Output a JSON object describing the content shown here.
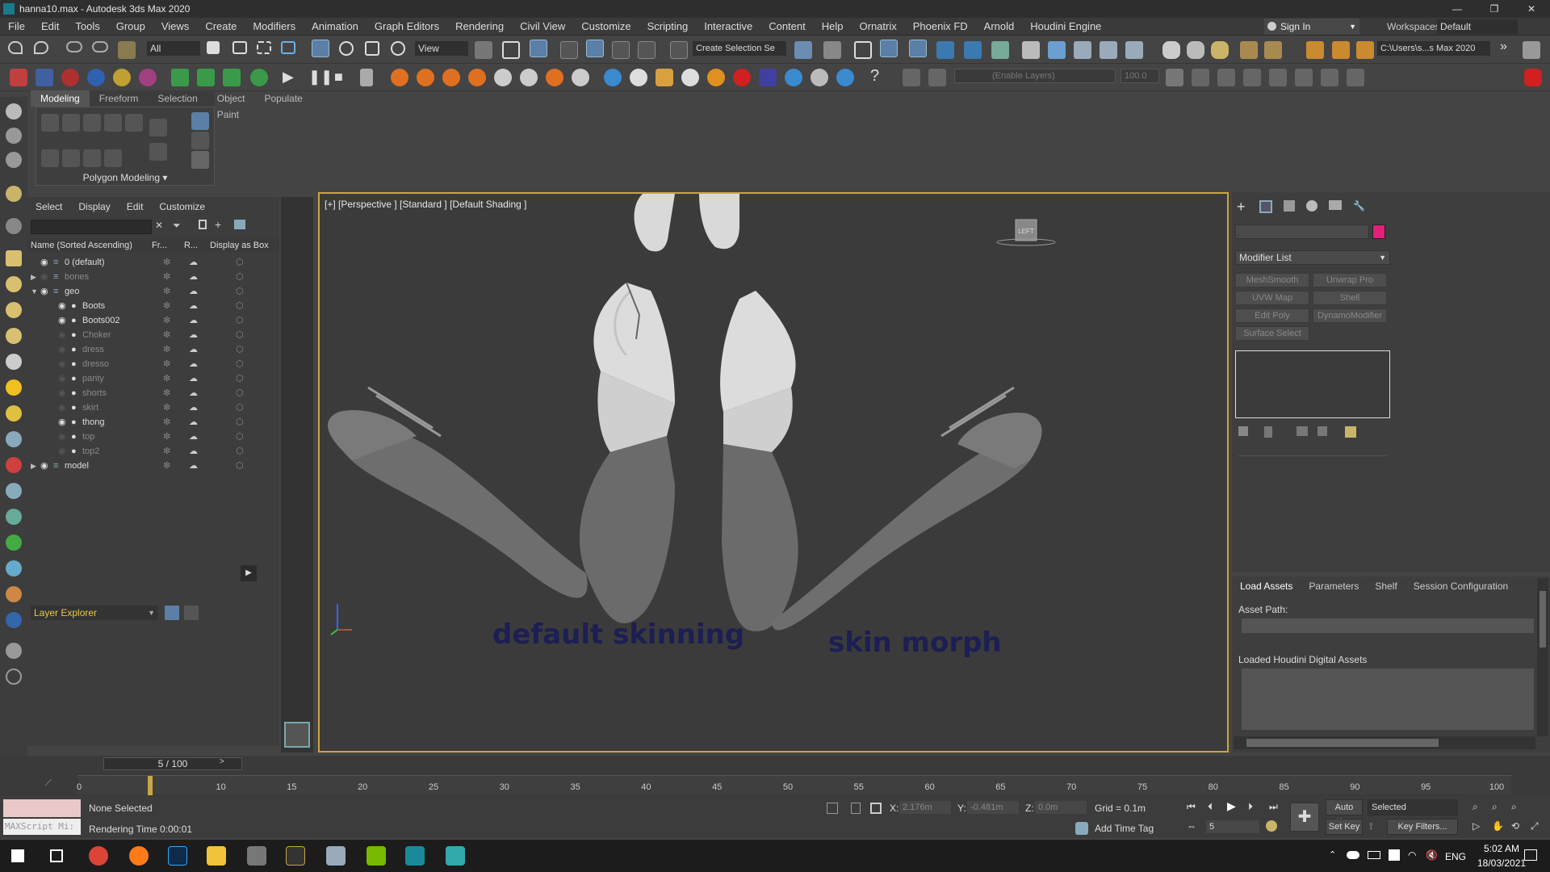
{
  "window": {
    "title": "hanna10.max - Autodesk 3ds Max 2020",
    "min": "—",
    "max": "❐",
    "close": "✕"
  },
  "menu": {
    "items": [
      "File",
      "Edit",
      "Tools",
      "Group",
      "Views",
      "Create",
      "Modifiers",
      "Animation",
      "Graph Editors",
      "Rendering",
      "Civil View",
      "Customize",
      "Scripting",
      "Interactive",
      "Content",
      "Help",
      "Ornatrix",
      "Phoenix FD",
      "Arnold",
      "Houdini Engine"
    ],
    "sign_in": "Sign In",
    "workspaces_label": "Workspaces:",
    "workspaces_value": "Default"
  },
  "toolbar": {
    "filter": "All",
    "view": "View",
    "selection_set": "Create Selection Se",
    "path": "C:\\Users\\s...s Max 2020",
    "layers": "(Enable Layers)",
    "value": "100.0"
  },
  "ribbon": {
    "tabs": [
      "Modeling",
      "Freeform",
      "Selection",
      "Object Paint",
      "Populate"
    ],
    "panel_label": "Polygon Modeling"
  },
  "scene_explorer": {
    "menu": [
      "Select",
      "Display",
      "Edit",
      "Customize"
    ],
    "columns": [
      "Name (Sorted Ascending)",
      "Fr...",
      "R...",
      "Display as Box"
    ],
    "rows": [
      {
        "name": "0 (default)",
        "level": 1,
        "visible": true
      },
      {
        "name": "bones",
        "level": 1,
        "visible": false,
        "expandable": true
      },
      {
        "name": "geo",
        "level": 1,
        "visible": true,
        "expanded": true
      },
      {
        "name": "Boots",
        "level": 2,
        "visible": true
      },
      {
        "name": "Boots002",
        "level": 2,
        "visible": true
      },
      {
        "name": "Choker",
        "level": 2,
        "visible": false
      },
      {
        "name": "dress",
        "level": 2,
        "visible": false
      },
      {
        "name": "dresso",
        "level": 2,
        "visible": false
      },
      {
        "name": "panty",
        "level": 2,
        "visible": false
      },
      {
        "name": "shorts",
        "level": 2,
        "visible": false
      },
      {
        "name": "skirt",
        "level": 2,
        "visible": false
      },
      {
        "name": "thong",
        "level": 2,
        "visible": true
      },
      {
        "name": "top",
        "level": 2,
        "visible": false
      },
      {
        "name": "top2",
        "level": 2,
        "visible": false
      },
      {
        "name": "model",
        "level": 1,
        "visible": true,
        "expandable": true
      }
    ],
    "explorer_mode": "Layer Explorer"
  },
  "viewport": {
    "label": "[+] [Perspective ] [Standard ] [Default Shading ]",
    "caption_left": "default skinning",
    "caption_right": "skin morph",
    "viewcube": "LEFT"
  },
  "command_panel": {
    "modifier_list": "Modifier List",
    "color": "#e0207a",
    "buttons": [
      "MeshSmooth",
      "Unwrap Pro",
      "UVW Map",
      "Shell",
      "Edit Poly",
      "DynamoModifier",
      "Surface Select"
    ]
  },
  "houdini": {
    "tabs": [
      "Load Assets",
      "Parameters",
      "Shelf",
      "Session Configuration"
    ],
    "asset_path_label": "Asset Path:",
    "loaded_label": "Loaded Houdini Digital Assets"
  },
  "timeline": {
    "frame": "5 / 100",
    "current": 5,
    "total": 100,
    "ticks": [
      "0",
      "5",
      "10",
      "15",
      "20",
      "25",
      "30",
      "35",
      "40",
      "45",
      "50",
      "55",
      "60",
      "65",
      "70",
      "75",
      "80",
      "85",
      "90",
      "95",
      "100"
    ]
  },
  "status": {
    "maxscript": "MAXScript Mi:",
    "selection": "None Selected",
    "render_time": "Rendering Time  0:00:01",
    "x_label": "X:",
    "x": "2.176m",
    "y_label": "Y:",
    "y": "-0.481m",
    "z_label": "Z:",
    "z": "0.0m",
    "grid": "Grid = 0.1m",
    "add_time_tag": "Add Time Tag",
    "auto_key": "Auto Key",
    "selected": "Selected",
    "set_key": "Set Key",
    "key_filters": "Key Filters...",
    "frame_field": "5"
  },
  "taskbar": {
    "lang": "ENG",
    "time": "5:02 AM",
    "date": "18/03/2021"
  }
}
